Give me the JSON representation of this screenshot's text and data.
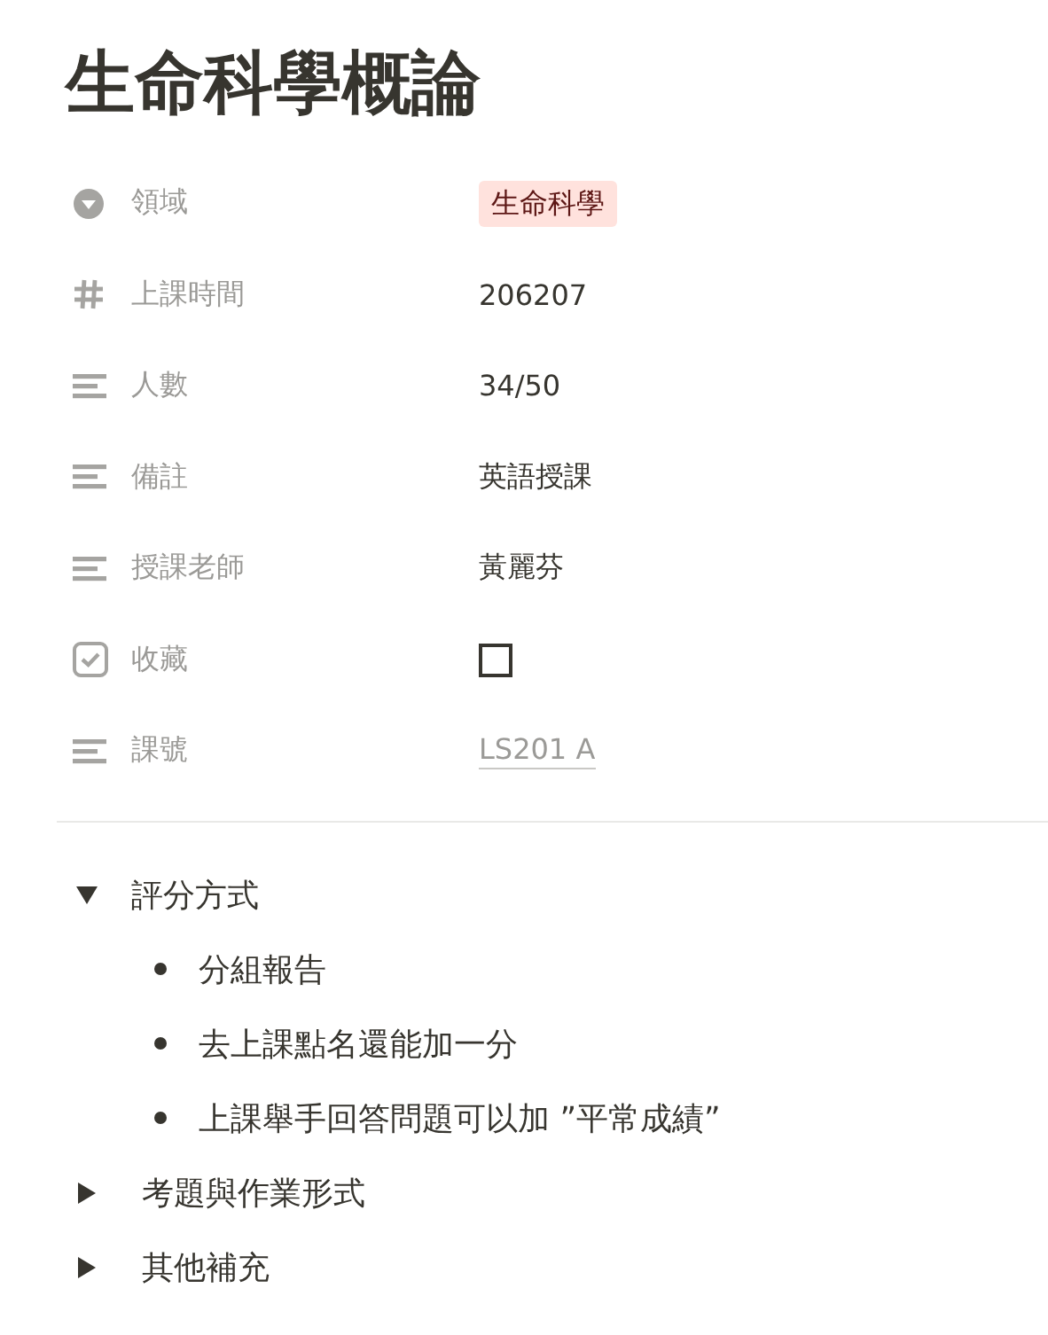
{
  "title": "生命科學概論",
  "properties": [
    {
      "kind": "select",
      "label": "領域",
      "value": "生命科學",
      "color": "#ffe2dd"
    },
    {
      "kind": "number",
      "label": "上課時間",
      "value": "206207"
    },
    {
      "kind": "text",
      "label": "人數",
      "value": "34/50"
    },
    {
      "kind": "text",
      "label": "備註",
      "value": "英語授課"
    },
    {
      "kind": "text",
      "label": "授課老師",
      "value": "黃麗芬"
    },
    {
      "kind": "checkbox",
      "label": "收藏",
      "checked": false
    },
    {
      "kind": "link",
      "label": "課號",
      "value": "LS201 A"
    }
  ],
  "toggles": [
    {
      "label": "評分方式",
      "expanded": true,
      "children": [
        "分組報告",
        "去上課點名還能加一分",
        "上課舉手回答問題可以加 ”平常成績”"
      ]
    },
    {
      "label": "考題與作業形式",
      "expanded": false
    },
    {
      "label": "其他補充",
      "expanded": false
    }
  ]
}
